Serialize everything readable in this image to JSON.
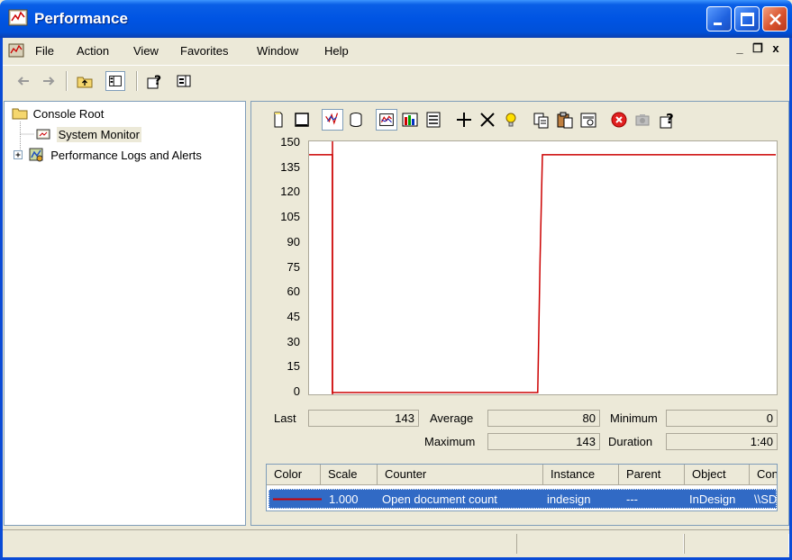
{
  "window": {
    "title": "Performance",
    "app_icon": "performance-monitor-icon",
    "title_bar_color": "#0054e3",
    "controls": [
      "minimize-icon",
      "maximize-icon",
      "close-icon"
    ]
  },
  "menubar": {
    "items": [
      "File",
      "Action",
      "View",
      "Favorites",
      "Window",
      "Help"
    ],
    "mdi_controls": [
      "_",
      "❐",
      "x"
    ]
  },
  "toolbar": {
    "buttons": [
      "back-arrow-icon",
      "forward-arrow-icon",
      "up-folder-icon",
      "show-hide-tree-icon",
      "help-icon",
      "action-pane-icon"
    ]
  },
  "tree": {
    "items": [
      {
        "label": "Console Root",
        "icon": "folder-icon"
      },
      {
        "label": "System Monitor",
        "icon": "system-monitor-icon",
        "selected": true
      },
      {
        "label": "Performance Logs and Alerts",
        "icon": "performance-logs-icon",
        "expander": "+"
      }
    ]
  },
  "monitor_toolbar": {
    "buttons": [
      "new-counter-set-icon",
      "clear-display-icon",
      "view-current-activity-icon",
      "view-log-data-icon",
      "view-graph-icon",
      "view-histogram-icon",
      "view-report-icon",
      "add-counter-icon",
      "delete-counter-icon",
      "highlight-icon",
      "copy-properties-icon",
      "paste-counter-list-icon",
      "properties-icon",
      "freeze-display-icon",
      "update-data-icon",
      "help-icon"
    ]
  },
  "chart_data": {
    "type": "line",
    "ylim": [
      0,
      150
    ],
    "y_ticks": [
      "150",
      "135",
      "120",
      "105",
      "90",
      "75",
      "60",
      "45",
      "30",
      "15",
      "0"
    ],
    "series": [
      {
        "color": "#cc0000",
        "x": [
          0,
          5,
          5,
          49,
          49.5,
          50,
          100
        ],
        "values": [
          143,
          143,
          0,
          0,
          80,
          143,
          143
        ]
      }
    ]
  },
  "stats": {
    "last_label": "Last",
    "last_value": "143",
    "average_label": "Average",
    "average_value": "80",
    "minimum_label": "Minimum",
    "minimum_value": "0",
    "maximum_label": "Maximum",
    "maximum_value": "143",
    "duration_label": "Duration",
    "duration_value": "1:40"
  },
  "counters": {
    "columns": [
      "Color",
      "Scale",
      "Counter",
      "Instance",
      "Parent",
      "Object",
      "Con"
    ],
    "rows": [
      {
        "color": "#cc0000",
        "scale": "1.000",
        "counter": "Open document count",
        "instance": "indesign",
        "parent": "---",
        "object": "InDesign",
        "computer": "\\\\SD"
      }
    ],
    "selection_color": "#316ac5"
  }
}
